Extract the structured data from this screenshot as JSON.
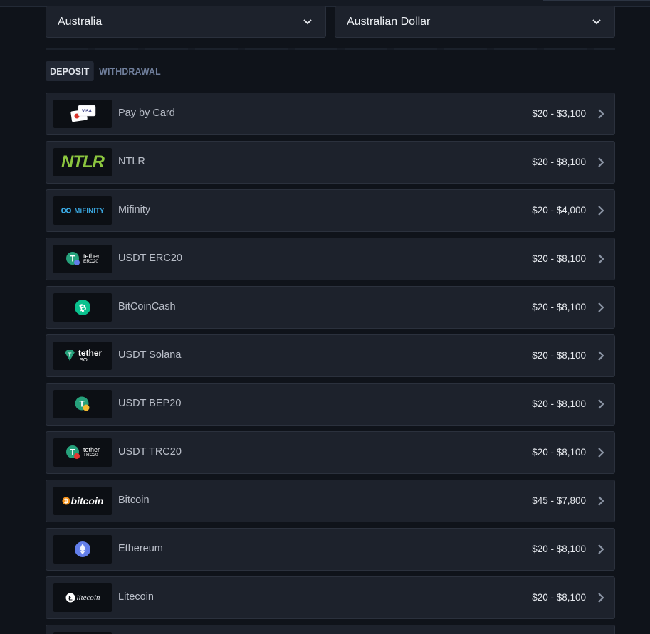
{
  "filters": {
    "country": "Australia",
    "currency": "Australian Dollar"
  },
  "tabs": [
    {
      "label": "DEPOSIT",
      "active": true
    },
    {
      "label": "WITHDRAWAL",
      "active": false
    }
  ],
  "methods": [
    {
      "name": "Pay by Card",
      "range": "$20 - $3,100",
      "logo": "card-icon",
      "logo_text": "VISA"
    },
    {
      "name": "NTLR",
      "range": "$20 - $8,100",
      "logo": "ntlr-logo",
      "logo_text": "NTLR"
    },
    {
      "name": "Mifinity",
      "range": "$20 - $4,000",
      "logo": "mifinity-logo",
      "logo_text": "MiFINITY"
    },
    {
      "name": "USDT ERC20",
      "range": "$20 - $8,100",
      "logo": "tether-erc20-logo",
      "logo_text": "tether",
      "logo_sub": "ERC20"
    },
    {
      "name": "BitCoinCash",
      "range": "$20 - $8,100",
      "logo": "bitcoin-cash-logo"
    },
    {
      "name": "USDT Solana",
      "range": "$20 - $8,100",
      "logo": "tether-sol-logo",
      "logo_text": "tether",
      "logo_sub": "SOL"
    },
    {
      "name": "USDT BEP20",
      "range": "$20 - $8,100",
      "logo": "tether-bep20-logo"
    },
    {
      "name": "USDT TRC20",
      "range": "$20 - $8,100",
      "logo": "tether-trc20-logo",
      "logo_text": "tether",
      "logo_sub": "TRC20"
    },
    {
      "name": "Bitcoin",
      "range": "$45 - $7,800",
      "logo": "bitcoin-logo",
      "logo_text": "bitcoin"
    },
    {
      "name": "Ethereum",
      "range": "$20 - $8,100",
      "logo": "ethereum-logo"
    },
    {
      "name": "Litecoin",
      "range": "$20 - $8,100",
      "logo": "litecoin-logo",
      "logo_text": "litecoin"
    }
  ],
  "colors": {
    "background": "#0f131a",
    "row": "#1d222c",
    "tether": "#26a17b",
    "bitcoin_cash": "#0ac18e",
    "bitcoin": "#f7931a",
    "ethereum": "#627eea",
    "ntlr": "#8cc63f",
    "mifinity": "#3aa7e0"
  }
}
